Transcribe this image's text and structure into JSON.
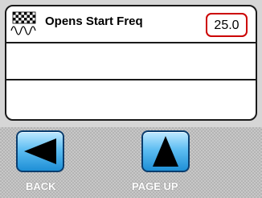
{
  "list": {
    "rows": [
      {
        "icon": "checkered-flag-frequency-icon",
        "label": "Opens Start Freq",
        "value": "25.0"
      },
      {
        "label": "",
        "value": ""
      },
      {
        "label": "",
        "value": ""
      }
    ]
  },
  "toolbar": {
    "back_label": "BACK",
    "page_up_label": "PAGE UP",
    "back_icon": "arrow-left-icon",
    "page_up_icon": "arrow-up-icon"
  },
  "colors": {
    "value_border": "#cc0000",
    "button_blue": "#1e8fd6",
    "toolbar_bg": "#c8c8c8"
  }
}
